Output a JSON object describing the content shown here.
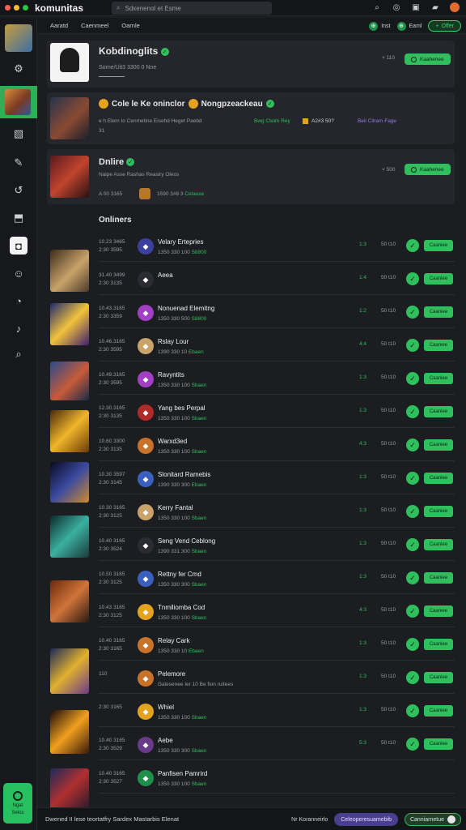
{
  "app": {
    "title": "komunitas",
    "traffic_lights": [
      "#ff5f57",
      "#febc2e",
      "#28c840"
    ]
  },
  "search": {
    "placeholder": "Sdxenenol et Esme"
  },
  "nav": {
    "links": [
      "Aaratd",
      "Caenmeel",
      "Oarnle"
    ],
    "right_items": [
      {
        "label": "Inst",
        "icon": "community-icon"
      },
      {
        "label": "Eaml",
        "icon": "community-icon"
      }
    ],
    "offer_label": "Offer"
  },
  "profile": {
    "name": "Kobdinoglits",
    "subtitle": "Sorne/Uit3 3300 0 Nne",
    "count": "× 110",
    "follow_label": "Kaahenee"
  },
  "feature": {
    "title_a": "Cole le Ke oninclor",
    "title_b": "Nongpzeackeau",
    "desc": "e h Elem Io Cenmetine Eisehd Heget Paebd",
    "tag_green": "Bwg Cteirk Rey",
    "tag_num": "A2#3 50?",
    "tag_purple": "Beil Cilram Fage",
    "footnote": "31"
  },
  "online": {
    "title": "Dnlire",
    "subtitle": "Naipe Asse Rashas Reasiry Oleos",
    "count": "× 500",
    "follow_label": "Kaahenee",
    "meta_left": "A 00 3165",
    "meta_mid": "1590 3#8 3",
    "meta_green": "Celause"
  },
  "list": {
    "heading": "Onliners",
    "rows": [
      {
        "rank_a": "10.23 3465",
        "rank_b": "2:30 3595",
        "title": "Velary Ertepries",
        "sub": "1350 330 100",
        "sub_green": "S8800",
        "num": "1:3",
        "meta": "50 t10",
        "btn": "Caaniee"
      },
      {
        "rank_a": "31.40 3499",
        "rank_b": "2:30 3135",
        "title": "Aeea",
        "sub": "",
        "sub_green": "",
        "num": "1:4",
        "meta": "50 t10",
        "btn": "Caaniee"
      },
      {
        "rank_a": "10.43.3165",
        "rank_b": "2:30 3359",
        "title": "Nonuenad Elemitng",
        "sub": "1350 330 500",
        "sub_green": "S8800",
        "num": "1:2",
        "meta": "50 t10",
        "btn": "Caaniee"
      },
      {
        "rank_a": "10.46.3165",
        "rank_b": "2:30 3595",
        "title": "Rslay Lour",
        "sub": "1390 330 10",
        "sub_green": "Ebaen",
        "num": "4:4",
        "meta": "50 t10",
        "btn": "Caaniee"
      },
      {
        "rank_a": "10.49.3165",
        "rank_b": "2:30 3595",
        "title": "Ravyntits",
        "sub": "1350 330 100",
        "sub_green": "Sbaen",
        "num": "1:3",
        "meta": "50 t10",
        "btn": "Caaniee"
      },
      {
        "rank_a": "12.30.3165",
        "rank_b": "2:30 3135",
        "title": "Yang bes Perpal",
        "sub": "1350 330 100",
        "sub_green": "Sbaen",
        "num": "1:3",
        "meta": "50 t10",
        "btn": "Caaniee"
      },
      {
        "rank_a": "10.60 3300",
        "rank_b": "2:30 3135",
        "title": "Warxd3ed",
        "sub": "1350 330 100",
        "sub_green": "Sbaen",
        "num": "4:3",
        "meta": "50 t10",
        "btn": "Caaniee"
      },
      {
        "rank_a": "10.30 3597",
        "rank_b": "2:30 3145",
        "title": "Slonitard Ramebis",
        "sub": "1390 330 300",
        "sub_green": "Ebaen",
        "num": "1:3",
        "meta": "50 t10",
        "btn": "Caaniee"
      },
      {
        "rank_a": "10.30 3165",
        "rank_b": "2:30 3125",
        "title": "Kerry Fantal",
        "sub": "1350 330 100",
        "sub_green": "Sbaen",
        "num": "1:3",
        "meta": "50 t10",
        "btn": "Caaniee"
      },
      {
        "rank_a": "10.40 3165",
        "rank_b": "2:30 3524",
        "title": "Seng Vend Ceblong",
        "sub": "1390 331 300",
        "sub_green": "Sbaen",
        "num": "1:3",
        "meta": "50 t10",
        "btn": "Caaniee"
      },
      {
        "rank_a": "10.50 3165",
        "rank_b": "2:30 3125",
        "title": "Rettny fer Cmd",
        "sub": "1350 330 300",
        "sub_green": "Sbaen",
        "num": "1:3",
        "meta": "50 t10",
        "btn": "Caaniee"
      },
      {
        "rank_a": "10.43 3165",
        "rank_b": "2:30 3125",
        "title": "Tnmiliomba Cod",
        "sub": "1350 330 100",
        "sub_green": "Sbaen",
        "num": "4:3",
        "meta": "50 t10",
        "btn": "Caaniee"
      },
      {
        "rank_a": "10.40 3165",
        "rank_b": "2:30 3165",
        "title": "Relay Cark",
        "sub": "1350 330 10",
        "sub_green": "Ebaen",
        "num": "1:3",
        "meta": "50 t10",
        "btn": "Caaniee"
      },
      {
        "rank_a": "110",
        "rank_b": "",
        "title": "Pelemore",
        "sub": "Galesenee Ier 10 Be fion ruitees",
        "sub_green": "",
        "num": "1:3",
        "meta": "50 t10",
        "btn": "Caaniee"
      },
      {
        "rank_a": "2:30 3165",
        "rank_b": "",
        "title": "Whiel",
        "sub": "1350 330 100",
        "sub_green": "Sbaen",
        "num": "1:3",
        "meta": "50 t10",
        "btn": "Caaniee"
      },
      {
        "rank_a": "10.40 3165",
        "rank_b": "2:30 3529",
        "title": "Aebe",
        "sub": "1350 330 300",
        "sub_green": "Sbaen",
        "num": "5:3",
        "meta": "50 t10",
        "btn": "Caaniee"
      },
      {
        "rank_a": "10.40 3165",
        "rank_b": "2:30 3527",
        "title": "Panfisen Pamrird",
        "sub": "1350 330 100",
        "sub_green": "Sbaen",
        "num": "",
        "meta": "",
        "btn": ""
      }
    ]
  },
  "sidebar_cta": {
    "label_a": "Ngat",
    "label_b": "Selos"
  },
  "bottom": {
    "text": "Dwened II lese teortatfry Sardex Mastarbis Elenat",
    "link": "Nr Koranneirlo",
    "purple_label": "Celeoperesuamebib",
    "green_label": "Canniarnetue"
  },
  "colors": {
    "accent": "#2fbf5d",
    "background": "#1b1d21",
    "panel": "#24262b",
    "purple": "#4a3f8f"
  }
}
